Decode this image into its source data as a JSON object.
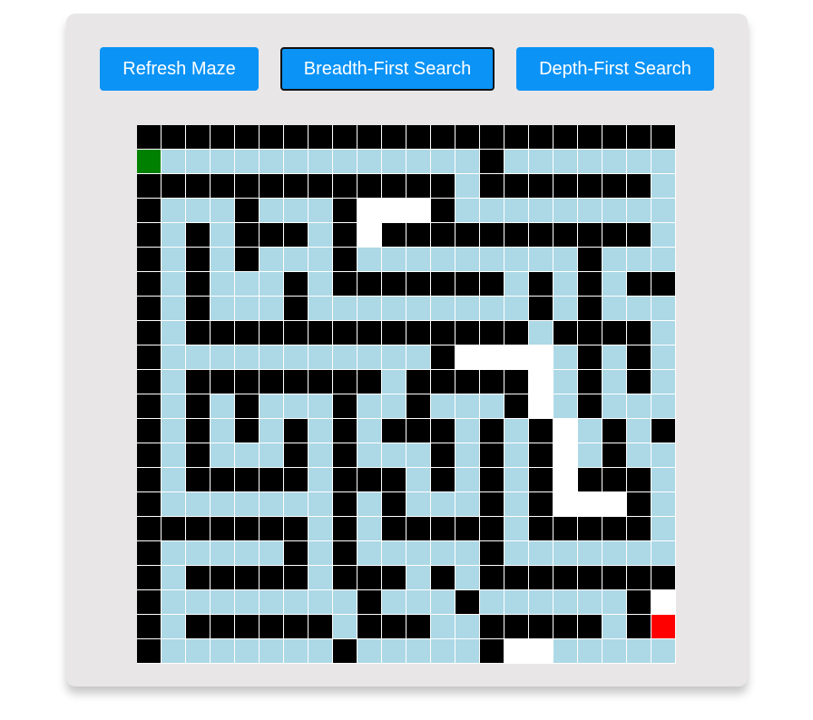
{
  "buttons": {
    "refresh": "Refresh Maze",
    "bfs": "Breadth-First Search",
    "dfs": "Depth-First Search"
  },
  "maze": {
    "legend": {
      "W": "wall",
      "P": "visited",
      "O": "unvisited",
      "S": "start",
      "E": "end"
    },
    "colors": {
      "wall": "#000000",
      "visited": "#add8e6",
      "unvisited": "#ffffff",
      "start": "#008000",
      "end": "#ff0000",
      "button": "#0b93f6",
      "panel": "#e8e6e7"
    },
    "rows": [
      "WWWWWWWWWWWWWWWWWWWWWW",
      "SPPPPPPPPPPPPPWPPPPPPP",
      "WWWWWWWWWWWWWPWWWWWWWP",
      "WPPPWPPPWOOOWPPPPPPPPP",
      "WPWPWWWPWOWWWWWWWWWWWP",
      "WPWPWPPPWPPPPPPPPPWPPP",
      "WPWPPPWPWWWWWWWPWPWPWW",
      "WPWPPPWPPPPPPPPPWPWPPP",
      "WPWWWWWWWWWWWWWWPWWWWP",
      "WPPPPPPPPPPPWOOOOPWPWP",
      "WPWWWWWWWWPWWWWWOPWPWP",
      "WPWPWPPPWPPWPPPWOPWPPP",
      "WPWPWPWPWPWWWPWPWOPWPW",
      "WPWPPPWPWPPPWPWPWOPWPP",
      "WPWWWWWPWWWPWPWPWOWWWP",
      "WPPPPPPPWPWPPPWPWOOOWP",
      "WWWWWWWPWPWWWWWPWWWWWP",
      "WPPPPPWPWPPPPPWPPPPPPP",
      "WPWWWWWPWWWPWPWWWWWWWW",
      "WPPPPPPPPWPPPWPPPPPPWO",
      "WPWWWWWWPWWWPPWWWWWPWE",
      "WPPPPPPPWPPPPPWOOPPPPP"
    ]
  }
}
